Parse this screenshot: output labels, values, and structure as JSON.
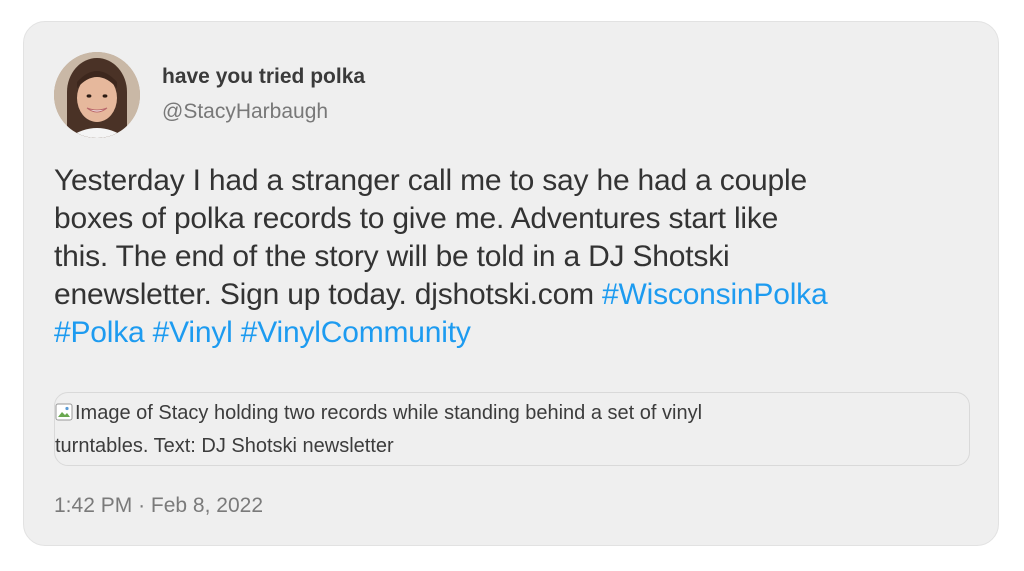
{
  "tweet": {
    "author": {
      "display_name": "have you tried polka",
      "handle": "@StacyHarbaugh",
      "avatar_icon": "profile-photo"
    },
    "text": {
      "line1": "Yesterday I had a stranger call me to say he had a couple",
      "line2": "boxes of polka records to give me. Adventures start like",
      "line3": "this. The end of the story will be told in a DJ Shotski",
      "line4_text": "enewsletter. Sign up today. ",
      "link": "djshotski.com",
      "hashtags": [
        "#WisconsinPolka",
        "#Polka",
        "#Vinyl",
        "#VinylCommunity"
      ]
    },
    "media": {
      "alt_line1": "Image of Stacy holding two records while standing behind a set of vinyl",
      "alt_line2": "turntables. Text: DJ Shotski newsletter",
      "icon": "broken-image-icon"
    },
    "time": "1:42 PM",
    "separator": "·",
    "date": "Feb 8, 2022",
    "colors": {
      "hashtag": "#1d9bf0",
      "card_background": "#efefef",
      "text": "#333333"
    }
  }
}
